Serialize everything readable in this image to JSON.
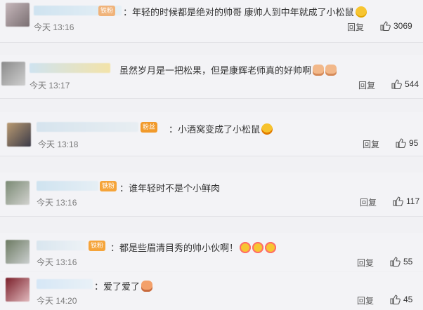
{
  "comments": [
    {
      "text": "：年轻的时候都是绝对的帅哥 康帅人到中年就成了小松鼠",
      "time": "今天 13:16",
      "reply": "回复",
      "likes": "3069",
      "emoji": [
        "smile"
      ]
    },
    {
      "text": "虽然岁月是一把松果，但是康辉老师真的好帅啊",
      "time": "今天 13:17",
      "reply": "回复",
      "likes": "544",
      "emoji": [
        "hand",
        "hand"
      ]
    },
    {
      "text": "：小酒窝变成了小松鼠",
      "time": "今天 13:18",
      "reply": "回复",
      "likes": "95",
      "emoji": [
        "laugh"
      ]
    },
    {
      "text": "：谁年轻时不是个小鲜肉",
      "time": "今天 13:16",
      "reply": "回复",
      "likes": "117",
      "emoji": []
    },
    {
      "text": "：都是些眉清目秀的帅小伙啊！",
      "time": "今天 13:16",
      "reply": "回复",
      "likes": "55",
      "emoji": [
        "kiss",
        "kiss",
        "kiss"
      ]
    },
    {
      "text": "：爱了爱了",
      "time": "今天 14:20",
      "reply": "回复",
      "likes": "45",
      "emoji": [
        "pet"
      ]
    }
  ],
  "badges": [
    "粉丝",
    "铁粉",
    "铁粉",
    "铁粉"
  ],
  "colors": {
    "background": "#f3f3f6",
    "text": "#333333",
    "time": "#7a7a7a",
    "badge": "#f5a43a"
  },
  "icons": {
    "like": "thumbs-up-icon"
  }
}
